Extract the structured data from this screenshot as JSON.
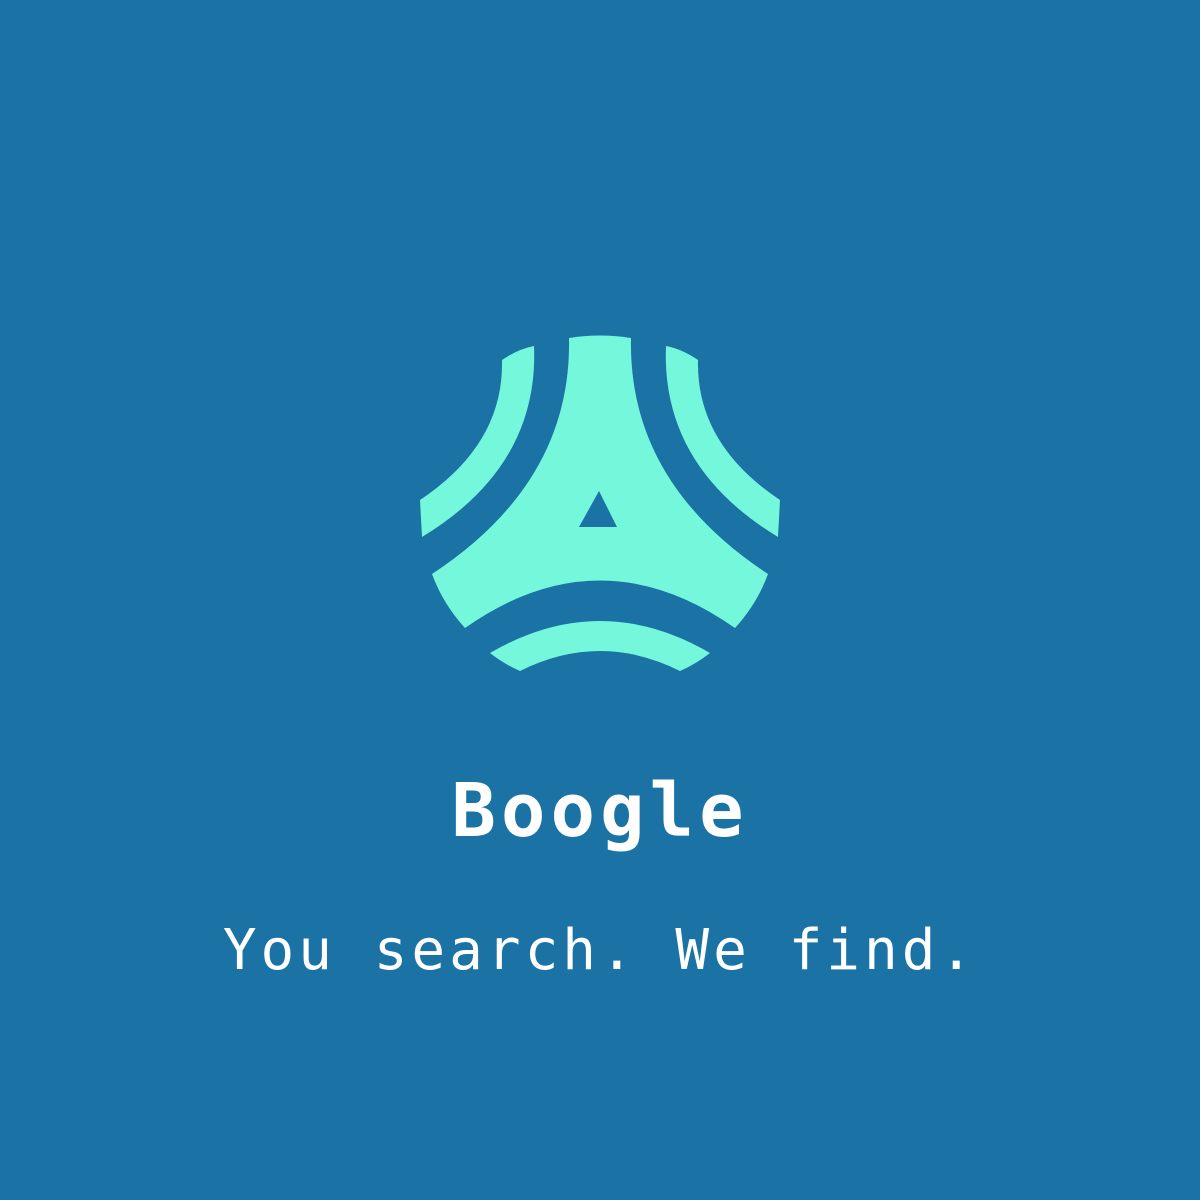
{
  "brand": {
    "name": "Boogle",
    "tagline": "You search. We find.",
    "logo_icon": "boogle-logo-icon"
  },
  "colors": {
    "background": "#1a72a5",
    "logo": "#75f7dc",
    "text": "#ffffff"
  }
}
